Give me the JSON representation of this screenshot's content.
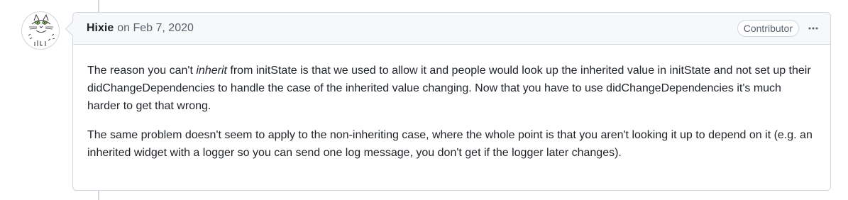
{
  "comment": {
    "author": "Hixie",
    "timestamp": "on Feb 7, 2020",
    "badge": "Contributor",
    "menu_icon": "kebab-horizontal-icon",
    "avatar_icon": "cat-avatar",
    "paragraph1": {
      "before": "The reason you can't ",
      "emphasis": "inherit",
      "after": " from initState is that we used to allow it and people would look up the inherited value in initState and not set up their didChangeDependencies to handle the case of the inherited value changing. Now that you have to use didChangeDependencies it's much harder to get that wrong."
    },
    "paragraph2": "The same problem doesn't seem to apply to the non-inheriting case, where the whole point is that you aren't looking it up to depend on it (e.g. an inherited widget with a logger so you can send one log message, you don't get if the logger later changes)."
  },
  "colors": {
    "border": "#d0d7de",
    "header_bg": "#f6f8fa",
    "text": "#1f2328",
    "muted": "#59636e"
  }
}
